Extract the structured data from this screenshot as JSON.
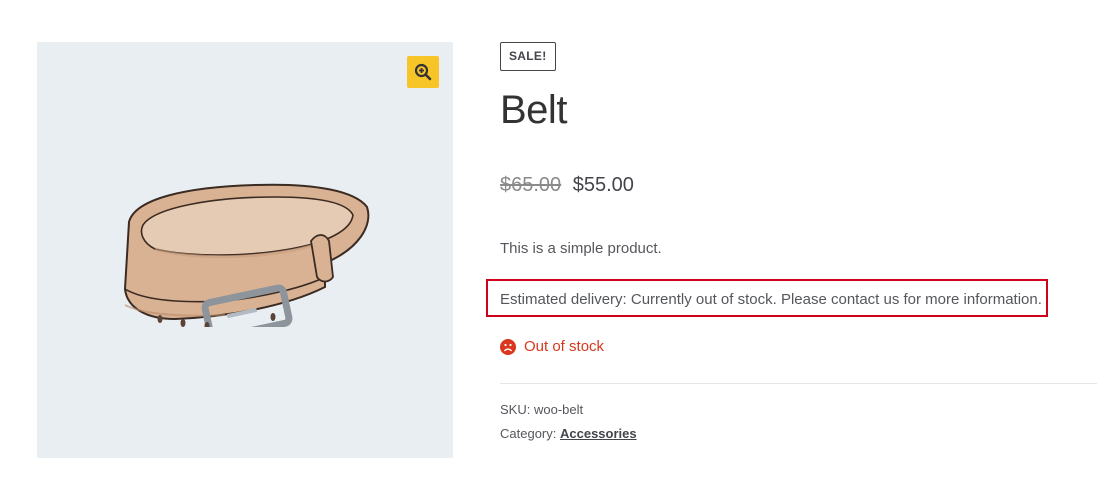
{
  "gallery": {
    "zoom_icon": "zoom-in-icon",
    "zoom_color": "#f8c528",
    "background": "#e9eef3"
  },
  "product": {
    "badge": "SALE!",
    "title": "Belt",
    "price_old": "$65.00",
    "price_new": "$55.00",
    "short_description": "This is a simple product.",
    "delivery_notice": "Estimated delivery: Currently out of stock. Please contact us for more information.",
    "stock_status": "Out of stock",
    "stock_icon": "frown-icon",
    "stock_color": "#d9381e",
    "highlight_color": "#d0021b",
    "meta": {
      "sku_label": "SKU:",
      "sku_value": "woo-belt",
      "category_label": "Category:",
      "category_value": "Accessories"
    }
  }
}
